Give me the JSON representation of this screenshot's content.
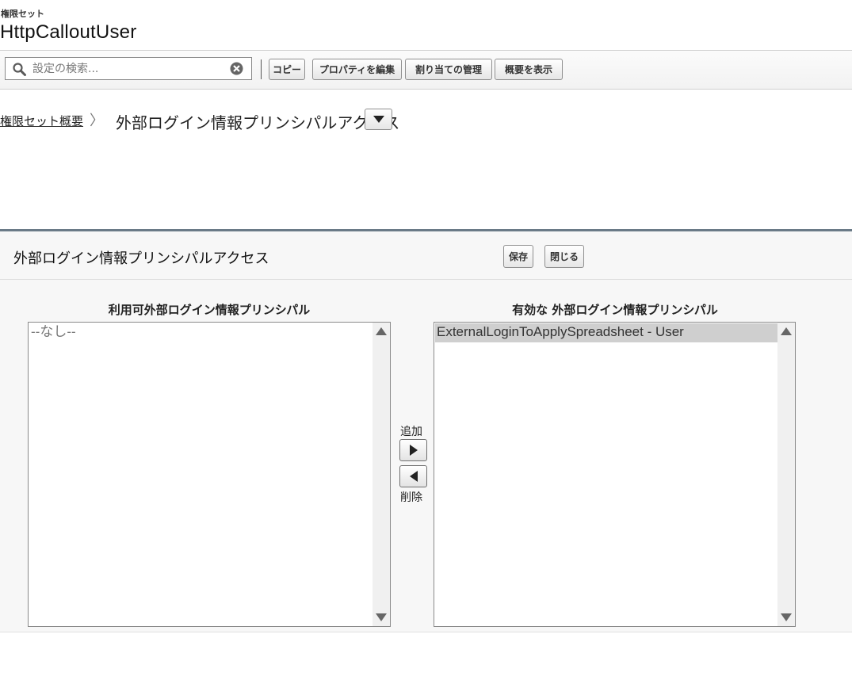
{
  "header": {
    "object_label": "権限セット",
    "object_name": "HttpCalloutUser"
  },
  "toolbar": {
    "search_placeholder": "設定の検索...",
    "buttons": [
      "コピー",
      "プロパティを編集",
      "割り当ての管理",
      "概要を表示"
    ]
  },
  "breadcrumb": {
    "parent": "権限セット概要",
    "separator": "〉",
    "current": "外部ログイン情報プリンシパルアクセス"
  },
  "panel": {
    "title": "外部ログイン情報プリンシパルアクセス",
    "save_label": "保存",
    "close_label": "閉じる",
    "available": {
      "title": "利用可外部ログイン情報プリンシパル",
      "items": [
        "--なし--"
      ]
    },
    "enabled": {
      "title": "有効な 外部ログイン情報プリンシパル",
      "items": [
        "ExternalLoginToApplySpreadsheet - User"
      ]
    },
    "add_label": "追加",
    "remove_label": "削除"
  }
}
